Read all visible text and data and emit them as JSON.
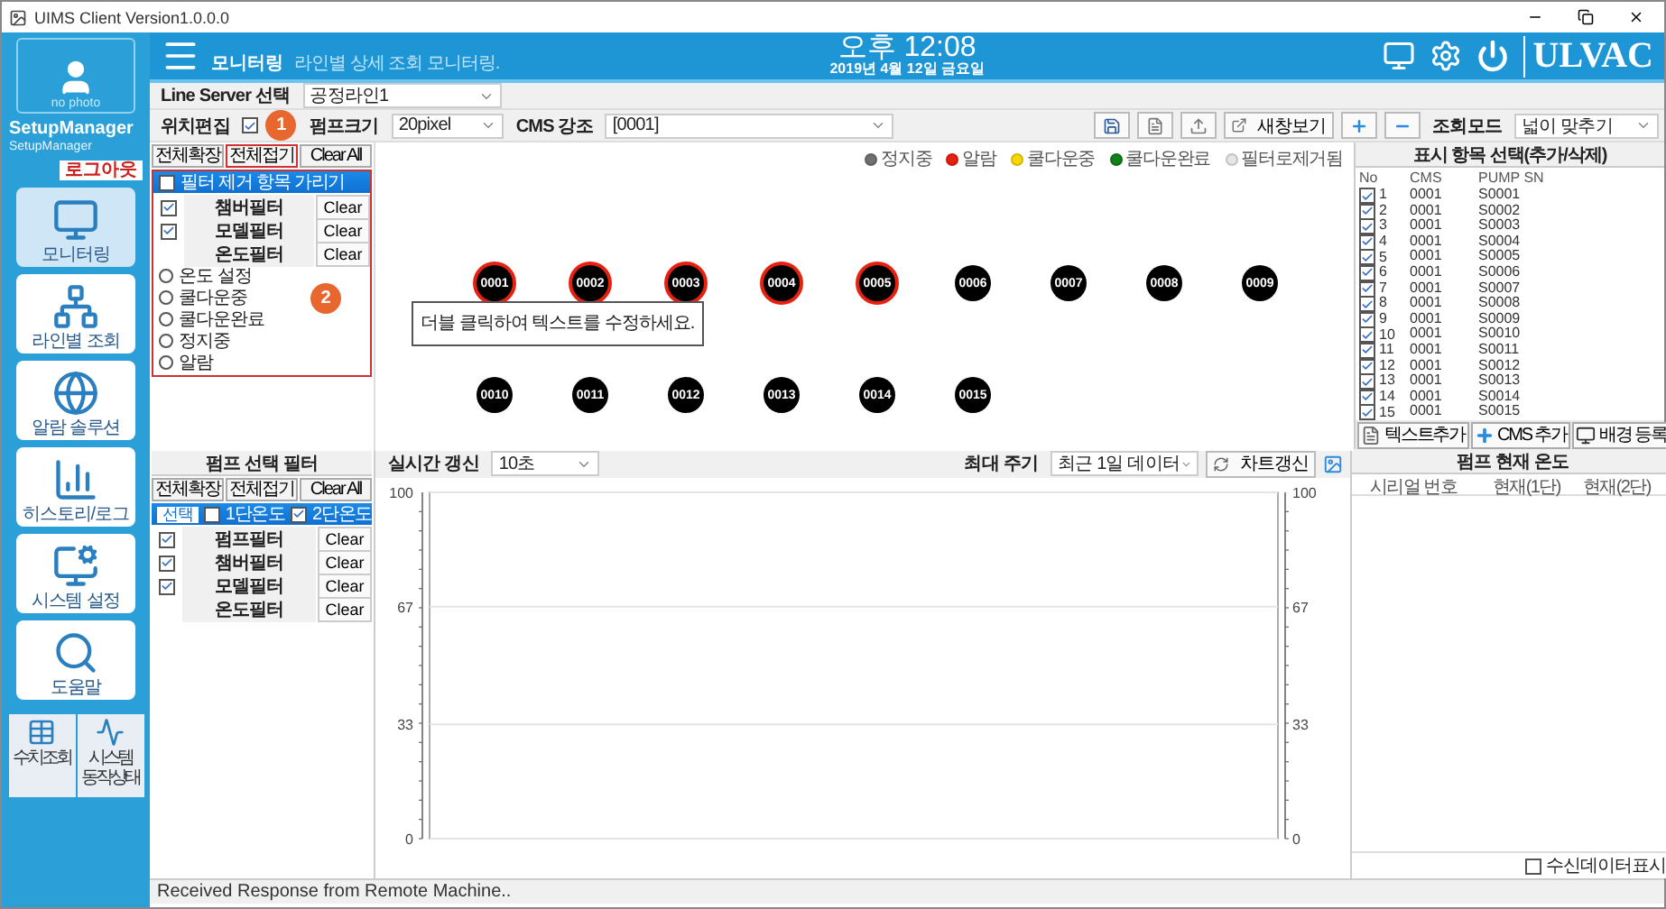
{
  "window": {
    "title": "UIMS Client Version1.0.0.0"
  },
  "user": {
    "photo": "no photo",
    "name": "SetupManager",
    "role": "SetupManager",
    "logout": "로그아웃"
  },
  "nav": [
    {
      "label": "모니터링",
      "selected": true
    },
    {
      "label": "라인별 조회",
      "selected": false
    },
    {
      "label": "알람 솔루션",
      "selected": false
    },
    {
      "label": "히스토리/로그",
      "selected": false
    },
    {
      "label": "시스템 설정",
      "selected": false
    },
    {
      "label": "도움말",
      "selected": false
    }
  ],
  "nav_small": [
    {
      "label": "수치조회"
    },
    {
      "label": "시스템 동작상태"
    }
  ],
  "header": {
    "title": "모니터링",
    "subtitle": "라인별 상세 조회 모니터링.",
    "time": "오후 12:08",
    "date": "2019년 4월 12일 금요일",
    "logo": "ULVAC"
  },
  "line_server": {
    "label": "Line Server 선택",
    "value": "공정라인1"
  },
  "toolbar": {
    "position_edit": {
      "label": "위치편집",
      "checked": true
    },
    "pump_size": {
      "label": "펌프크기",
      "value": "20pixel"
    },
    "cms_highlight": {
      "label": "CMS 강조",
      "value": "[0001]"
    },
    "new_window": "새창보기",
    "view_mode": {
      "label": "조회모드",
      "value": "넓이 맞추기"
    }
  },
  "annotations": [
    {
      "number": "1"
    },
    {
      "number": "2"
    }
  ],
  "filter_panel": {
    "buttons": [
      {
        "label": "전체확장",
        "highlighted": false
      },
      {
        "label": "전체접기",
        "highlighted": true
      },
      {
        "label": "Clear All",
        "highlighted": false
      }
    ],
    "hide_removed": {
      "label": "필터 제거 항목 가리기",
      "checked": false
    },
    "filters": [
      {
        "kind": "check",
        "label": "챔버필터",
        "checked": true,
        "clear": "Clear"
      },
      {
        "kind": "check",
        "label": "모델필터",
        "checked": true,
        "clear": "Clear"
      },
      {
        "kind": "plain",
        "label": "온도필터",
        "clear": "Clear"
      }
    ],
    "options": [
      {
        "label": "온도 설정",
        "selected": false
      },
      {
        "label": "쿨다운중",
        "selected": false
      },
      {
        "label": "쿨다운완료",
        "selected": false
      },
      {
        "label": "정지중",
        "selected": false
      },
      {
        "label": "알람",
        "selected": false
      }
    ]
  },
  "legend": [
    {
      "label": "정지중",
      "color": "#707070"
    },
    {
      "label": "알람",
      "color": "#e82010"
    },
    {
      "label": "쿨다운중",
      "color": "#f8d800"
    },
    {
      "label": "쿨다운완료",
      "color": "#108018"
    },
    {
      "label": "필터로제거됨",
      "color": "#e6e6e6"
    }
  ],
  "pumps": [
    [
      {
        "label": "0001",
        "alarm": true
      },
      {
        "label": "0002",
        "alarm": true
      },
      {
        "label": "0003",
        "alarm": true
      },
      {
        "label": "0004",
        "alarm": true
      },
      {
        "label": "0005",
        "alarm": true
      },
      {
        "label": "0006",
        "alarm": false
      },
      {
        "label": "0007",
        "alarm": false
      },
      {
        "label": "0008",
        "alarm": false
      },
      {
        "label": "0009",
        "alarm": false
      }
    ],
    [
      {
        "label": "0010",
        "alarm": false
      },
      {
        "label": "0011",
        "alarm": false
      },
      {
        "label": "0012",
        "alarm": false
      },
      {
        "label": "0013",
        "alarm": false
      },
      {
        "label": "0014",
        "alarm": false
      },
      {
        "label": "0015",
        "alarm": false
      }
    ]
  ],
  "note": "더블 클릭하여 텍스트를 수정하세요.",
  "item_panel": {
    "title": "표시 항목 선택(추가/삭제)",
    "columns": [
      "No",
      "CMS",
      "PUMP SN"
    ],
    "rows": [
      {
        "checked": true,
        "no": "1",
        "cms": "0001",
        "sn": "S0001"
      },
      {
        "checked": true,
        "no": "2",
        "cms": "0001",
        "sn": "S0002"
      },
      {
        "checked": true,
        "no": "3",
        "cms": "0001",
        "sn": "S0003"
      },
      {
        "checked": true,
        "no": "4",
        "cms": "0001",
        "sn": "S0004"
      },
      {
        "checked": true,
        "no": "5",
        "cms": "0001",
        "sn": "S0005"
      },
      {
        "checked": true,
        "no": "6",
        "cms": "0001",
        "sn": "S0006"
      },
      {
        "checked": true,
        "no": "7",
        "cms": "0001",
        "sn": "S0007"
      },
      {
        "checked": true,
        "no": "8",
        "cms": "0001",
        "sn": "S0008"
      },
      {
        "checked": true,
        "no": "9",
        "cms": "0001",
        "sn": "S0009"
      },
      {
        "checked": true,
        "no": "10",
        "cms": "0001",
        "sn": "S0010"
      },
      {
        "checked": true,
        "no": "11",
        "cms": "0001",
        "sn": "S0011"
      },
      {
        "checked": true,
        "no": "12",
        "cms": "0001",
        "sn": "S0012"
      },
      {
        "checked": true,
        "no": "13",
        "cms": "0001",
        "sn": "S0013"
      },
      {
        "checked": true,
        "no": "14",
        "cms": "0001",
        "sn": "S0014"
      },
      {
        "checked": true,
        "no": "15",
        "cms": "0001",
        "sn": "S0015"
      }
    ],
    "buttons": [
      "텍스트추가",
      "CMS 추가",
      "배경 등록"
    ]
  },
  "pump_filter": {
    "title": "펌프 선택 필터",
    "buttons": [
      "전체확장",
      "전체접기",
      "Clear All"
    ],
    "select_row": {
      "label": "선택",
      "options": [
        {
          "label": "1단온도",
          "checked": false
        },
        {
          "label": "2단온도",
          "checked": true
        }
      ]
    },
    "filters": [
      {
        "kind": "check",
        "label": "펌프필터",
        "checked": true,
        "clear": "Clear"
      },
      {
        "kind": "check",
        "label": "챔버필터",
        "checked": true,
        "clear": "Clear"
      },
      {
        "kind": "check",
        "label": "모델필터",
        "checked": true,
        "clear": "Clear"
      },
      {
        "kind": "plain",
        "label": "온도필터",
        "clear": "Clear"
      }
    ]
  },
  "chart_bar": {
    "refresh": {
      "label": "실시간 갱신",
      "value": "10초"
    },
    "period": {
      "label": "최대 주기",
      "value": "최근 1일 데이터"
    },
    "update": "차트갱신"
  },
  "chart": {
    "chart_data": {
      "type": "line",
      "categories": [
        null
      ],
      "ylim": [
        0,
        100
      ],
      "yticks": [
        0,
        33,
        67,
        100
      ]
    },
    "right_axis_ticks": [
      "100",
      "67",
      "33",
      "0"
    ]
  },
  "temp_panel": {
    "title": "펌프 현재 온도",
    "columns": [
      "시리얼 번호",
      "현재(1단)",
      "현재(2단)"
    ]
  },
  "show_received": {
    "label": "수신데이터표시",
    "checked": false
  },
  "status_bar": "Received Response from Remote Machine.."
}
